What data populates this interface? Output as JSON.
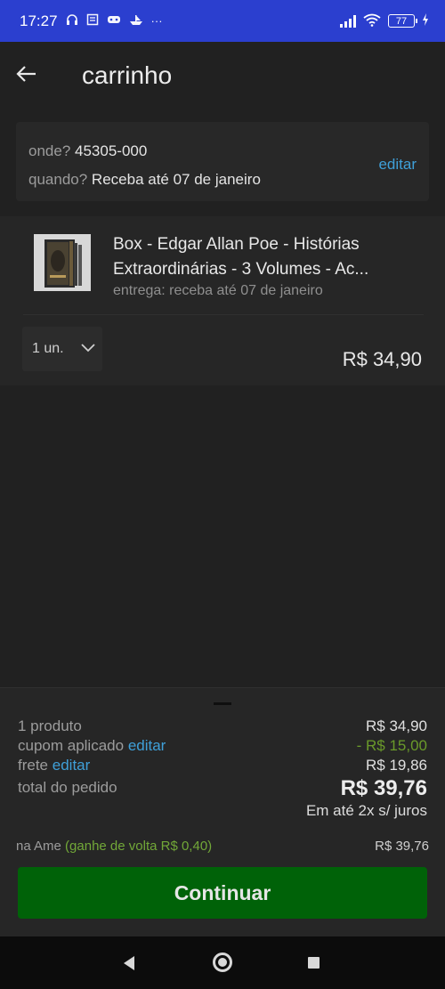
{
  "status_bar": {
    "time": "17:27",
    "notification_icons": [
      "headset-icon",
      "news-icon",
      "game-icon",
      "boat-icon",
      "more-dots-icon"
    ],
    "more": "···",
    "battery": "77"
  },
  "header": {
    "title": "carrinho"
  },
  "delivery": {
    "where_label": "onde?",
    "where_value": "45305-000",
    "when_label": "quando?",
    "when_value": "Receba até 07 de janeiro",
    "edit_label": "editar"
  },
  "product": {
    "name_line1": "Box - Edgar Allan Poe - Histórias",
    "name_line2": "Extraordinárias - 3 Volumes - Ac...",
    "delivery": "entrega: receba até 07 de janeiro",
    "quantity": "1 un.",
    "price": "R$ 34,90"
  },
  "summary": {
    "products_label": "1 produto",
    "products_value": "R$ 34,90",
    "coupon_label": "cupom aplicado",
    "coupon_edit": "editar",
    "coupon_value": "- R$ 15,00",
    "shipping_label": "frete",
    "shipping_edit": "editar",
    "shipping_value": "R$ 19,86",
    "total_label": "total do pedido",
    "total_value": "R$ 39,76",
    "installments": "Em até 2x s/ juros",
    "ame_label": "na Ame",
    "ame_bonus": "(ganhe de volta R$ 0,40)",
    "ame_value": "R$ 39,76",
    "continue_label": "Continuar"
  },
  "colors": {
    "status_bar": "#2b3fcf",
    "background": "#212121",
    "link": "#3fa0d9",
    "discount": "#6a9a2a",
    "cta": "#006208"
  }
}
